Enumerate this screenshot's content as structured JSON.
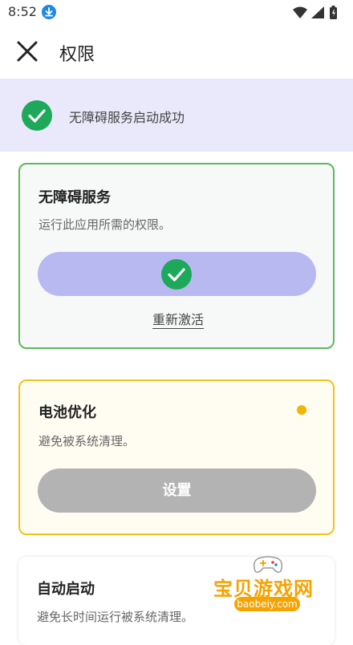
{
  "status_bar": {
    "time": "8:52",
    "download_icon": "download-icon",
    "wifi_icon": "wifi-icon",
    "signal_icon": "signal-icon",
    "battery_icon": "battery-icon"
  },
  "app_bar": {
    "close_icon": "close-icon",
    "title": "权限"
  },
  "banner": {
    "icon": "check-circle-icon",
    "text": "无障碍服务启动成功",
    "background": "#e9e9fb",
    "check_color": "#1ea85a"
  },
  "accessibility_card": {
    "title": "无障碍服务",
    "subtitle": "运行此应用所需的权限。",
    "status_icon": "check-circle-icon",
    "reactivate_label": "重新激活",
    "border_color": "#5cb85c",
    "pill_color": "#b9b9f2"
  },
  "battery_card": {
    "title": "电池优化",
    "subtitle": "避免被系统清理。",
    "button_label": "设置",
    "indicator_color": "#f2b705",
    "border_color": "#f2c21b"
  },
  "autostart_card": {
    "title": "自动启动",
    "subtitle": "避免长时间运行被系统清理。"
  },
  "watermark": {
    "text": "宝贝游戏网",
    "url": "baobeiy.com",
    "icon": "gamepad-icon"
  }
}
